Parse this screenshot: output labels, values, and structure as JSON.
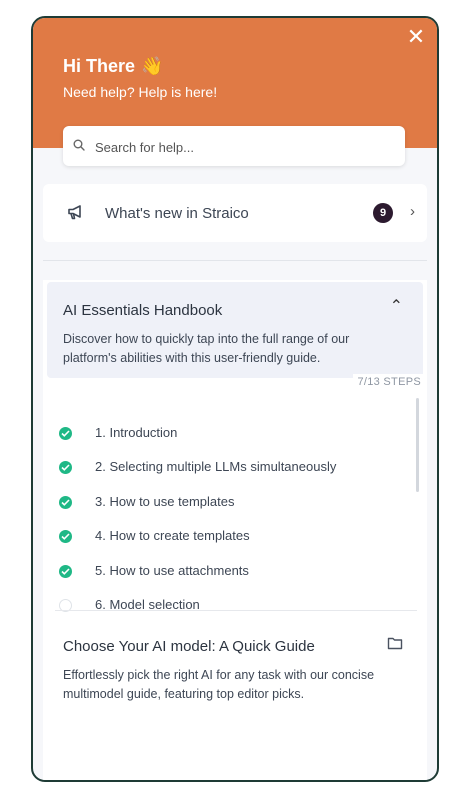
{
  "header": {
    "greeting": "Hi There",
    "wave_emoji": "👋",
    "subtitle": "Need help? Help is here!",
    "close_icon": "close-icon",
    "background_color": "#e07a45"
  },
  "search": {
    "placeholder": "Search for help...",
    "icon": "search-icon"
  },
  "whats_new": {
    "label": "What's new in Straico",
    "count": "9",
    "icon": "megaphone-icon",
    "chevron": "chevron-right-icon"
  },
  "handbook": {
    "title": "AI Essentials Handbook",
    "description": "Discover how to quickly tap into the full range of our platform's abilities with this user-friendly guide.",
    "progress": "7/13 STEPS",
    "steps_done": 7,
    "steps_total": 13,
    "expanded": true,
    "tasks": [
      {
        "label": "1. Introduction",
        "done": true
      },
      {
        "label": "2. Selecting multiple LLMs simultaneously",
        "done": true
      },
      {
        "label": "3. How to use templates",
        "done": true
      },
      {
        "label": "4. How to create templates",
        "done": true
      },
      {
        "label": "5. How to use attachments",
        "done": true
      },
      {
        "label": "6. Model selection",
        "done": false
      }
    ]
  },
  "guide": {
    "title": "Choose Your AI model: A Quick Guide",
    "description": "Effortlessly pick the right AI for any task with our concise multimodel guide, featuring top editor picks.",
    "icon": "folder-icon"
  },
  "colors": {
    "accent": "#e07a45",
    "check": "#1fb886",
    "badge": "#2c1a2f",
    "border": "#1e3b35"
  }
}
